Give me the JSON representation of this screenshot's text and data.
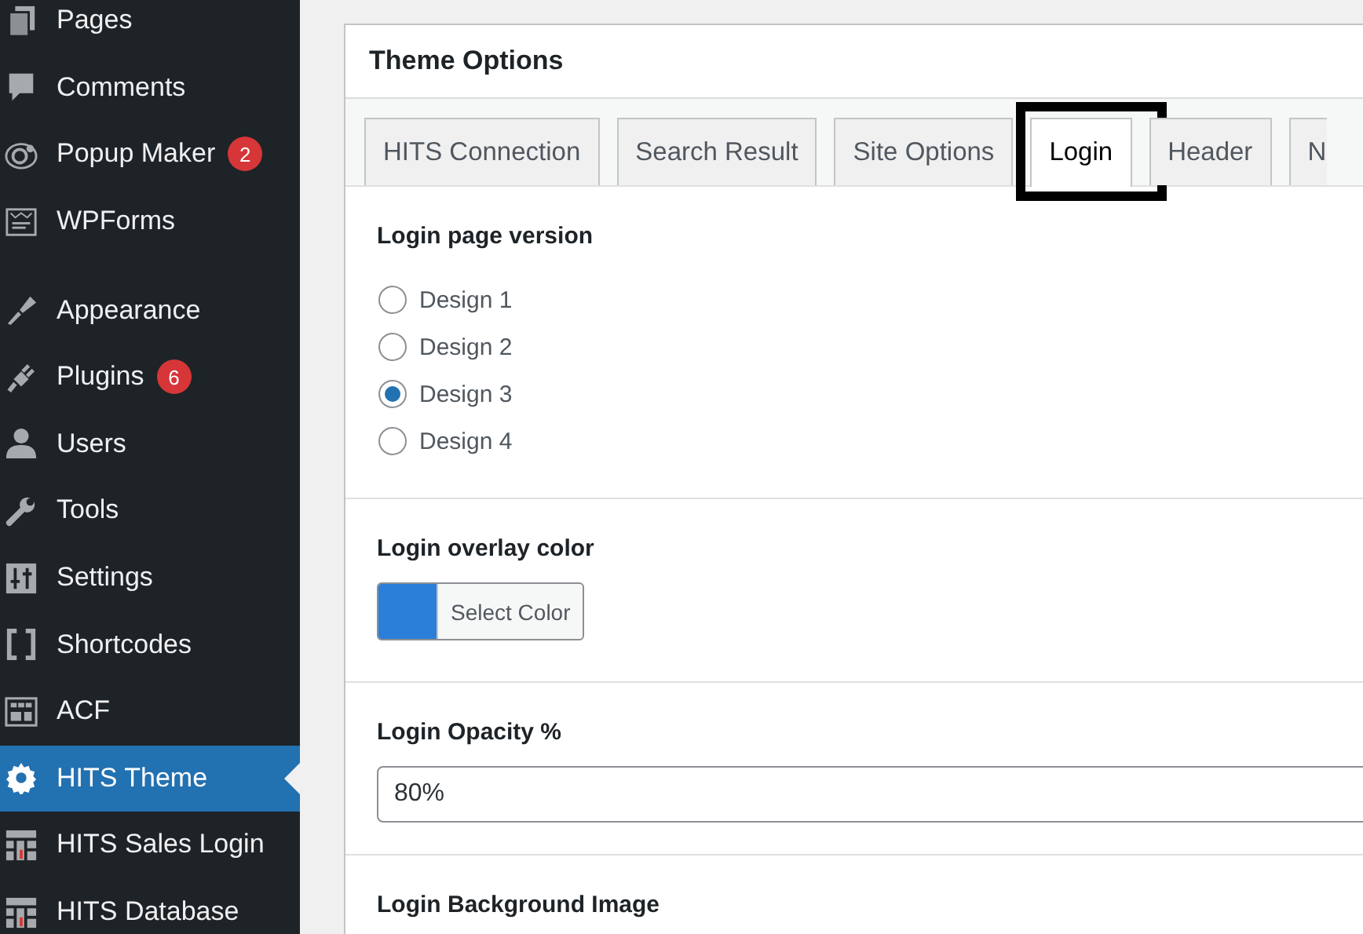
{
  "sidebar": {
    "groups": [
      {
        "items": [
          {
            "label": "Pages",
            "selected": false
          },
          {
            "label": "Comments",
            "selected": false
          },
          {
            "label": "Popup Maker",
            "badge": "2",
            "selected": false
          },
          {
            "label": "WPForms",
            "selected": false
          }
        ]
      },
      {
        "items": [
          {
            "label": "Appearance",
            "selected": false
          },
          {
            "label": "Plugins",
            "badge": "6",
            "selected": false
          },
          {
            "label": "Users",
            "selected": false
          },
          {
            "label": "Tools",
            "selected": false
          },
          {
            "label": "Settings",
            "selected": false
          },
          {
            "label": "Shortcodes",
            "selected": false
          },
          {
            "label": "ACF",
            "selected": false
          },
          {
            "label": "HITS Theme",
            "selected": true
          },
          {
            "label": "HITS Sales Login",
            "selected": false
          },
          {
            "label": "HITS Database",
            "selected": false
          }
        ]
      }
    ]
  },
  "panel": {
    "title": "Theme Options",
    "tabs": [
      {
        "label": "HITS Connection",
        "selected": false,
        "highlighted": false
      },
      {
        "label": "Search Result",
        "selected": false,
        "highlighted": false
      },
      {
        "label": "Site Options",
        "selected": false,
        "highlighted": false
      },
      {
        "label": "Login",
        "selected": true,
        "highlighted": true
      },
      {
        "label": "Header",
        "selected": false,
        "highlighted": false
      },
      {
        "label": "N",
        "selected": false,
        "highlighted": false
      }
    ],
    "sections": [
      {
        "kind": "radio",
        "heading": "Login page version",
        "options": [
          {
            "label": "Design 1",
            "selected": false
          },
          {
            "label": "Design 2",
            "selected": false
          },
          {
            "label": "Design 3",
            "selected": true
          },
          {
            "label": "Design 4",
            "selected": false
          }
        ]
      },
      {
        "kind": "color",
        "heading": "Login overlay color",
        "color": "#2b7fd8",
        "button": "Select Color"
      },
      {
        "kind": "text",
        "heading": "Login Opacity %",
        "value": "80%"
      },
      {
        "kind": "heading",
        "heading": "Login Background Image"
      }
    ]
  }
}
